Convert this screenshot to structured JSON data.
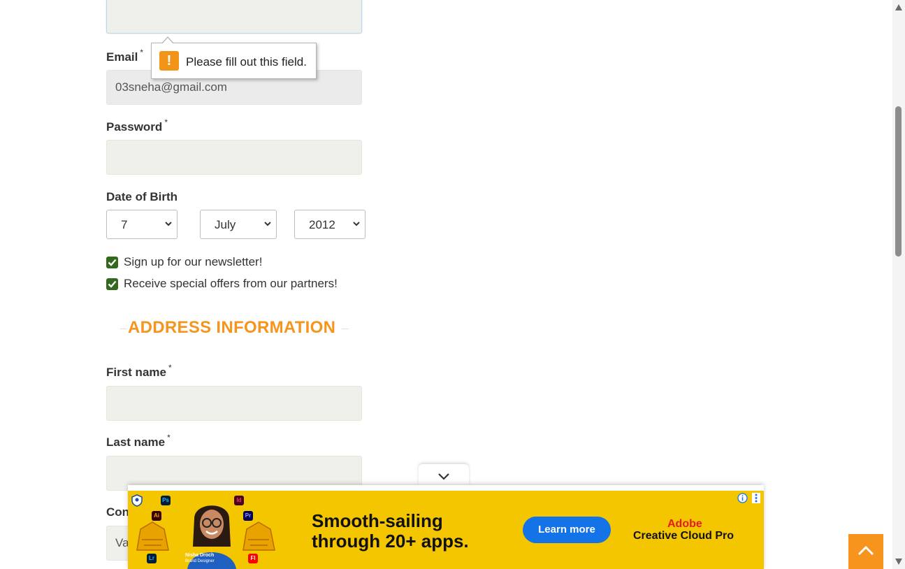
{
  "form": {
    "email_label": "Email",
    "email_value": "03sneha@gmail.com",
    "password_label": "Password",
    "dob_label": "Date of Birth",
    "dob_day": "7",
    "dob_month": "July",
    "dob_year": "2012",
    "newsletter_label": "Sign up for our newsletter!",
    "offers_label": "Receive special offers from our partners!",
    "required_mark": "*"
  },
  "tooltip": {
    "message": "Please fill out this field.",
    "icon": "!"
  },
  "address": {
    "section_title": "ADDRESS INFORMATION",
    "first_name_label": "First name",
    "last_name_label": "Last name",
    "company_label_partial": "Con",
    "company_value_partial": "Va"
  },
  "ad": {
    "headline_line1": "Smooth-sailing",
    "headline_line2": "through 20+ apps.",
    "cta": "Learn more",
    "brand_line1": "Adobe",
    "brand_line2": "Creative Cloud Pro",
    "person_name": "Nisha Droch",
    "person_role": "Brand Designer",
    "apps": [
      "Ps",
      "Id",
      "Ai",
      "Pr",
      "Lr",
      "Fl"
    ],
    "colors": {
      "background": "#f4c600",
      "cta": "#1473e6",
      "brand": "#e31c23"
    }
  },
  "colors": {
    "accent": "#f7941d",
    "checkbox": "#33691e",
    "field_bg": "#f0f0ea"
  }
}
